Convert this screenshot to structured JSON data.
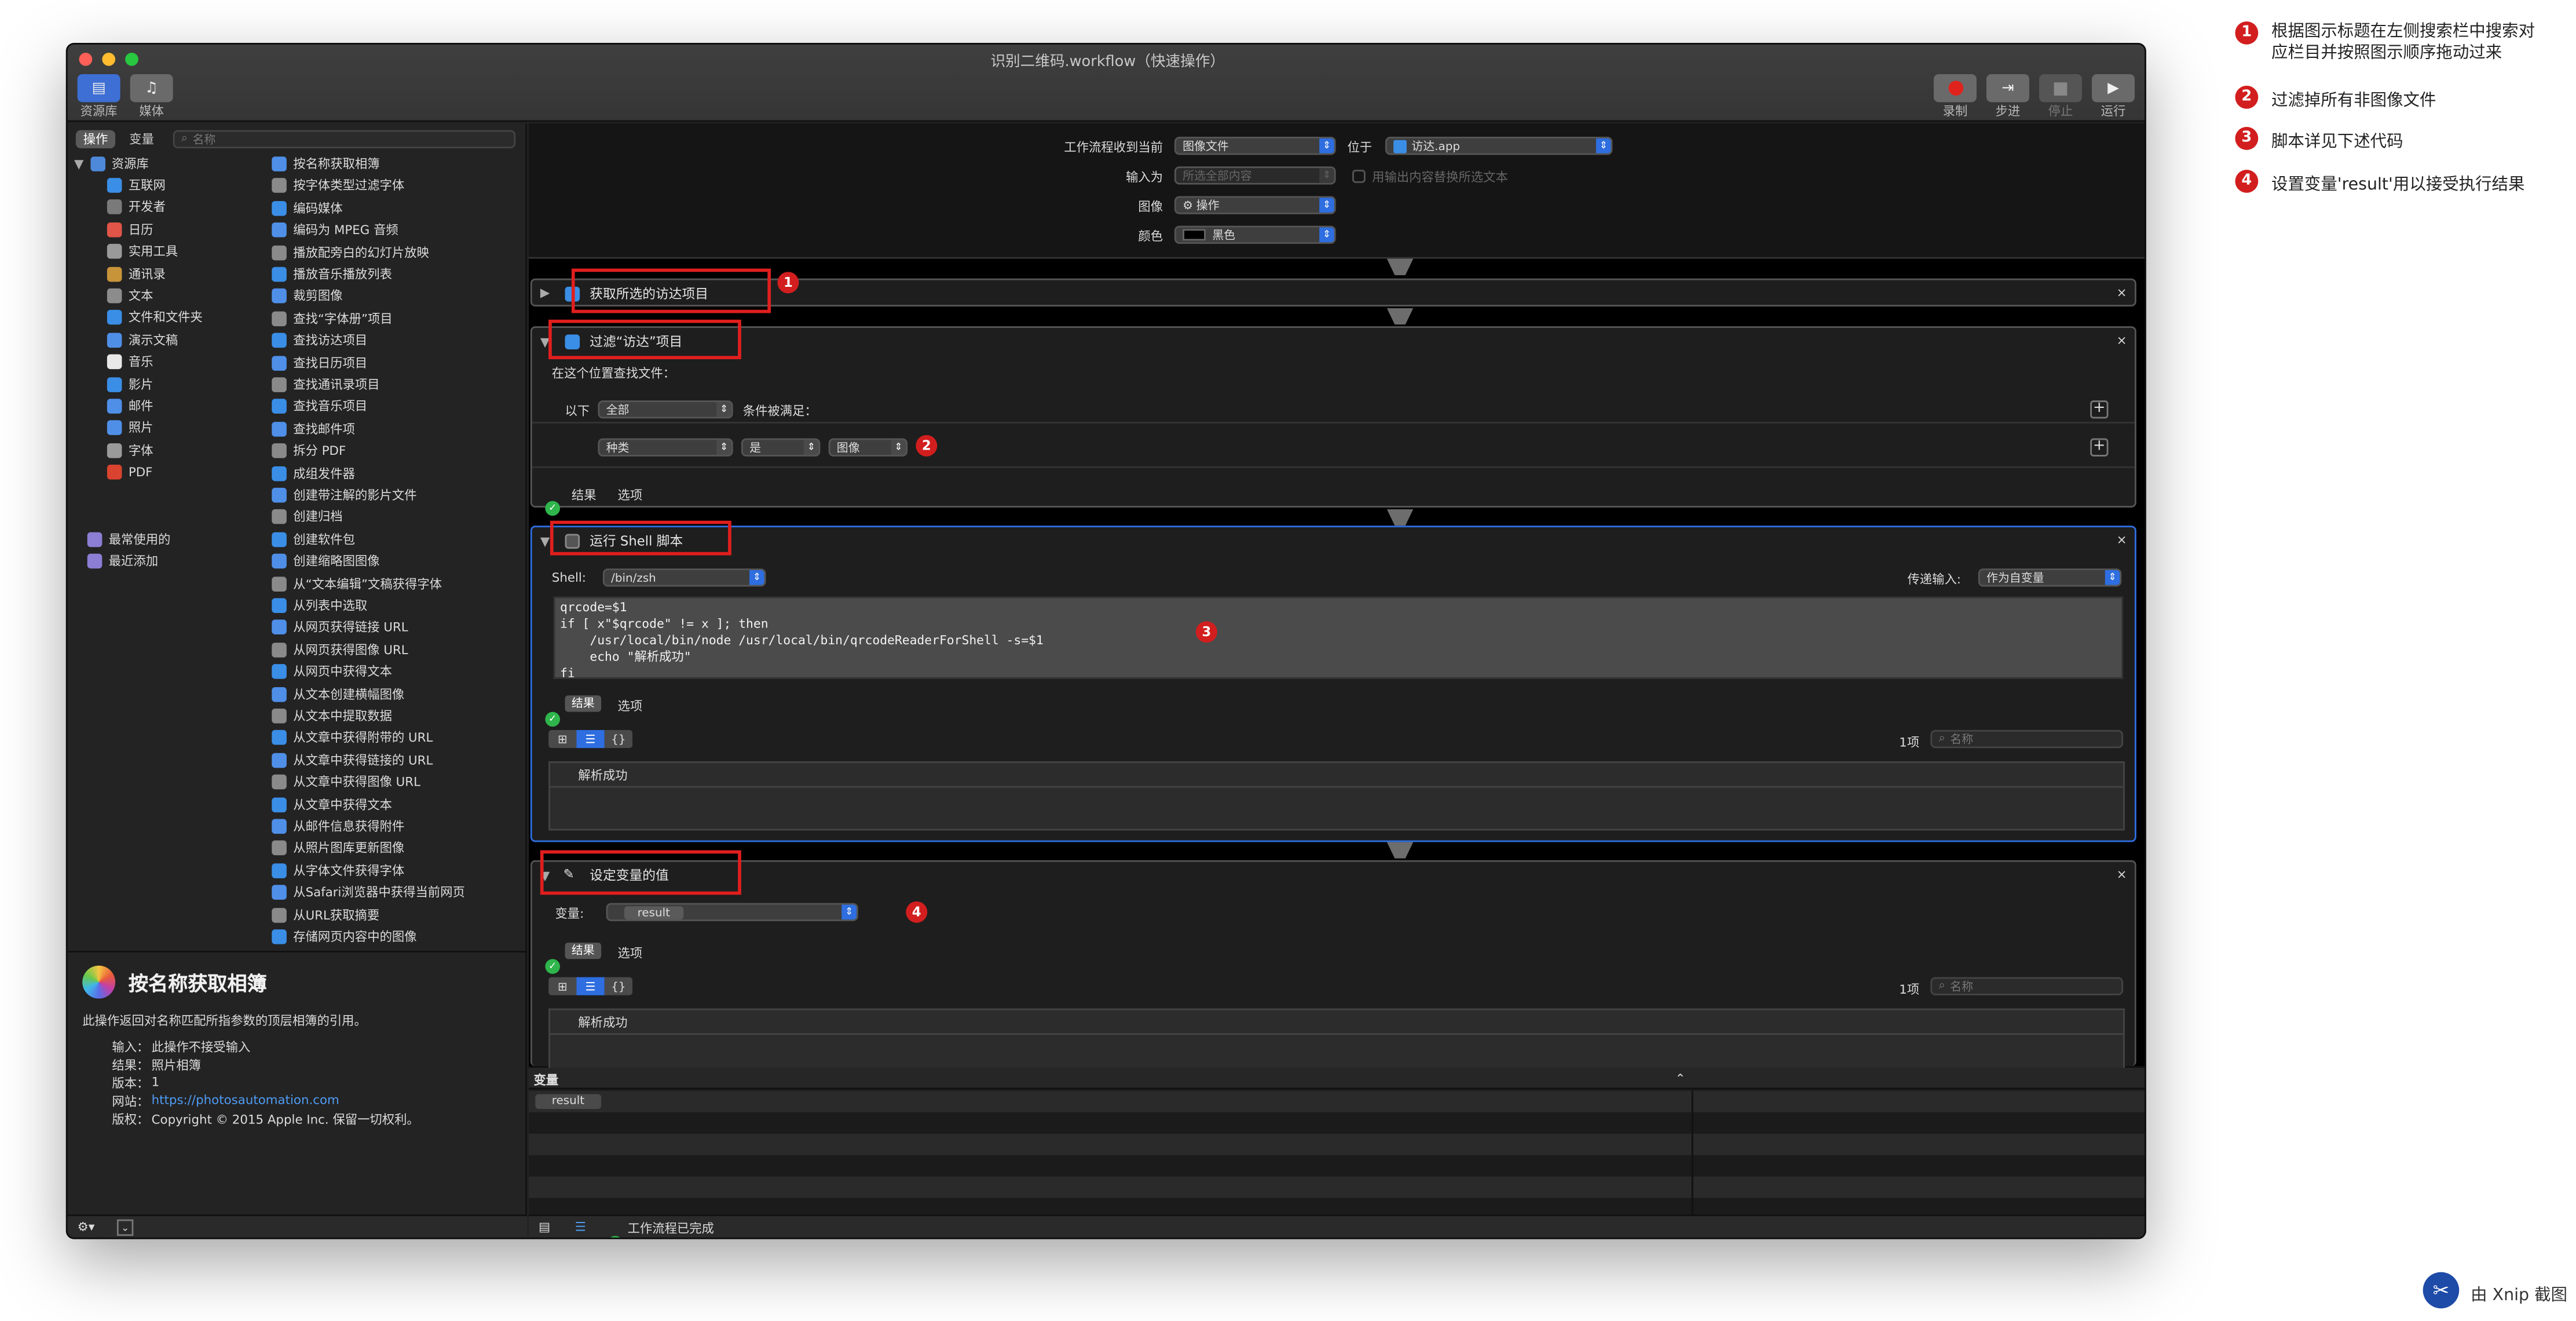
{
  "window": {
    "title": "识别二维码.workflow（快速操作）"
  },
  "toolbar": {
    "library_label": "资源库",
    "media_label": "媒体",
    "record_label": "录制",
    "step_label": "步进",
    "stop_label": "停止",
    "run_label": "运行"
  },
  "sidebar": {
    "tab_actions": "操作",
    "tab_variables": "变量",
    "search_placeholder": "名称",
    "library_root": "资源库",
    "categories": [
      "互联网",
      "开发者",
      "日历",
      "实用工具",
      "通讯录",
      "文本",
      "文件和文件夹",
      "演示文稿",
      "音乐",
      "影片",
      "邮件",
      "照片",
      "字体",
      "PDF"
    ],
    "recent_used": "最常使用的",
    "recent_added": "最近添加",
    "actions": [
      "按名称获取相簿",
      "按字体类型过滤字体",
      "编码媒体",
      "编码为 MPEG 音频",
      "播放配旁白的幻灯片放映",
      "播放音乐播放列表",
      "裁剪图像",
      "查找“字体册”项目",
      "查找访达项目",
      "查找日历项目",
      "查找通讯录项目",
      "查找音乐项目",
      "查找邮件项",
      "拆分 PDF",
      "成组发件器",
      "创建带注解的影片文件",
      "创建归档",
      "创建软件包",
      "创建缩略图图像",
      "从“文本编辑”文稿获得字体",
      "从列表中选取",
      "从网页获得链接 URL",
      "从网页获得图像 URL",
      "从网页中获得文本",
      "从文本创建横幅图像",
      "从文本中提取数据",
      "从文章中获得附带的 URL",
      "从文章中获得链接的 URL",
      "从文章中获得图像 URL",
      "从文章中获得文本",
      "从邮件信息获得附件",
      "从照片图库更新图像",
      "从字体文件获得字体",
      "从Safari浏览器中获得当前网页",
      "从URL获取摘要",
      "存储网页内容中的图像"
    ]
  },
  "info": {
    "title": "按名称获取相簿",
    "desc": "此操作返回对名称匹配所指参数的顶层相簿的引用。",
    "input_label": "输入：",
    "input_value": "此操作不接受输入",
    "result_label": "结果：",
    "result_value": "照片相簿",
    "version_label": "版本：",
    "version_value": "1",
    "website_label": "网站：",
    "website_value": "https://photosautomation.com",
    "copyright_label": "版权：",
    "copyright_value": "Copyright © 2015 Apple Inc. 保留一切权利。"
  },
  "header": {
    "receives_label": "工作流程收到当前",
    "receives_value": "图像文件",
    "in_label": "位于",
    "in_value": "访达.app",
    "input_is_label": "输入为",
    "input_is_value": "所选全部内容",
    "replace_label": "用输出内容替换所选文本",
    "image_label": "图像",
    "image_value": "操作",
    "color_label": "颜色",
    "color_value": "黑色"
  },
  "actions": {
    "a1": {
      "title": "获取所选的访达项目"
    },
    "a2": {
      "title": "过滤“访达”项目",
      "find_label": "在这个位置查找文件：",
      "below_label": "以下",
      "all_value": "全部",
      "cond_label": "条件被满足：",
      "kind_value": "种类",
      "is_value": "是",
      "img_value": "图像",
      "results_tab": "结果",
      "options_tab": "选项"
    },
    "a3": {
      "title": "运行 Shell 脚本",
      "shell_label": "Shell:",
      "shell_value": "/bin/zsh",
      "pass_label": "传递输入:",
      "pass_value": "作为自变量",
      "code_line1": "qrcode=$1",
      "code_line2": "if [ x\"$qrcode\" != x ]; then",
      "code_line3": "    /usr/local/bin/node /usr/local/bin/qrcodeReaderForShell -s=$1",
      "code_line4": "    echo \"解析成功\"",
      "code_line5": "fi",
      "results_tab": "结果",
      "options_tab": "选项",
      "count": "1项",
      "search_placeholder": "名称",
      "result_row": "解析成功"
    },
    "a4": {
      "title": "设定变量的值",
      "var_label": "变量:",
      "var_value": "result",
      "results_tab": "结果",
      "options_tab": "选项",
      "count": "1项",
      "search_placeholder": "名称",
      "result_row": "解析成功"
    }
  },
  "variables_panel": {
    "header": "变量",
    "item": "result"
  },
  "status": {
    "text": "工作流程已完成"
  },
  "annotations": {
    "n1": "1",
    "n2": "2",
    "n3": "3",
    "n4": "4",
    "note1_line1": "根据图示标题在左侧搜索栏中搜索对",
    "note1_line2": "应栏目并按照图示顺序拖动过来",
    "note2": "过滤掉所有非图像文件",
    "note3": "脚本详见下述代码",
    "note4": "设置变量'result'用以接受执行结果"
  },
  "watermark": "由 Xnip 截图",
  "colors": {
    "accent": "#2e6ee0",
    "annotation_red": "#d21e1e",
    "success_green": "#2eb54b"
  }
}
